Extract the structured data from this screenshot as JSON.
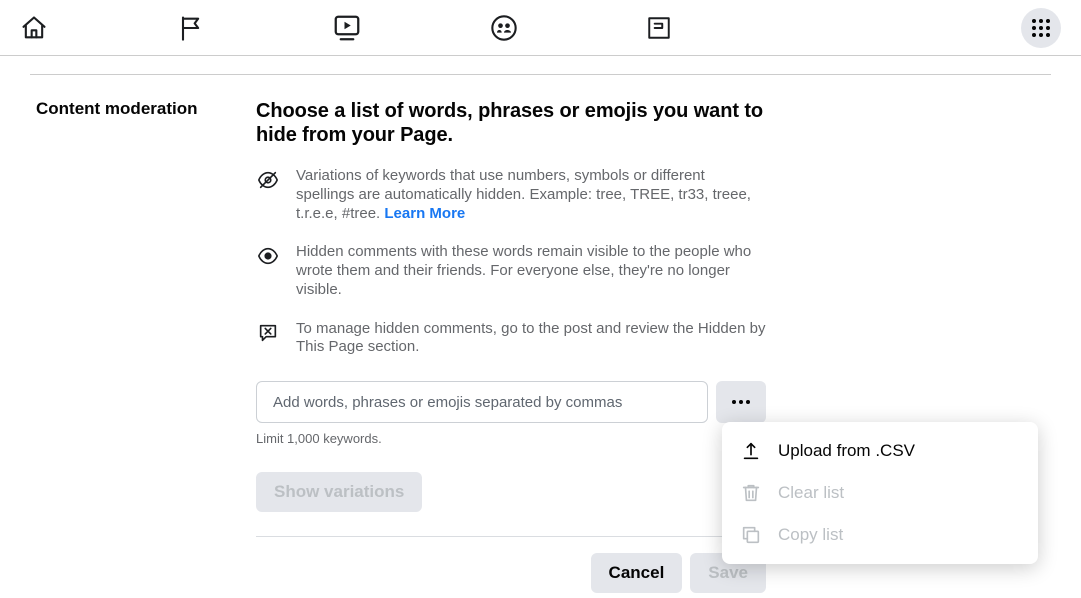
{
  "sidebar": {
    "title": "Content moderation"
  },
  "main": {
    "heading": "Choose a list of words, phrases or emojis you want to hide from your Page.",
    "info1": "Variations of keywords that use numbers, symbols or different spellings are automatically hidden. Example: tree, TREE, tr33, treee, t.r.e.e, #tree. ",
    "learn_more": "Learn More",
    "info2": "Hidden comments with these words remain visible to the people who wrote them and their friends. For everyone else, they're no longer visible.",
    "info3": "To manage hidden comments, go to the post and review the Hidden by This Page section.",
    "input_placeholder": "Add words, phrases or emojis separated by commas",
    "input_value": "",
    "limit": "Limit 1,000 keywords.",
    "show_variations": "Show variations",
    "cancel": "Cancel",
    "save": "Save"
  },
  "popover": {
    "upload": "Upload from .CSV",
    "clear": "Clear list",
    "copy": "Copy list"
  }
}
